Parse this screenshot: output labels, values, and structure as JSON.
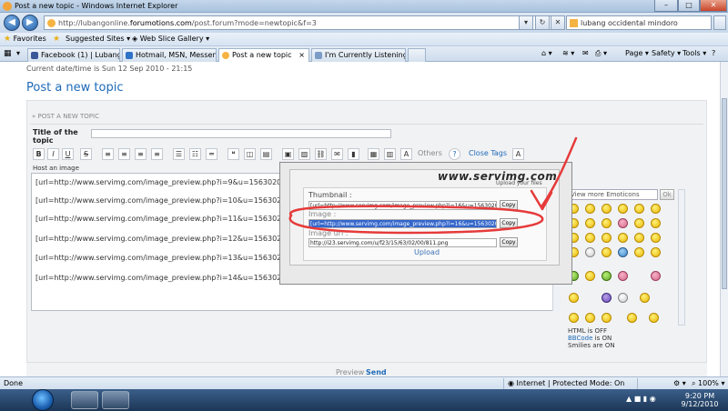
{
  "window": {
    "title": "Post a new topic - Windows Internet Explorer",
    "min": "–",
    "max": "□",
    "close": "✕"
  },
  "nav": {
    "url_host": "http://lubangonline.",
    "url_domain": "forumotions.com",
    "url_path": "/post.forum?mode=newtopic&f=3",
    "search_text": "lubang occidental mindoro",
    "refresh": "↻",
    "stop": "✕",
    "go": "→"
  },
  "favorites": {
    "label": "Favorites",
    "items": [
      "Suggested Sites ▾",
      "Web Slice Gallery ▾"
    ]
  },
  "tabs": [
    {
      "label": "Facebook (1) | Lubang Tou...",
      "color": "#3b5998"
    },
    {
      "label": "Hotmail, MSN, Messenger ...",
      "color": "#2f73c8"
    },
    {
      "label": "Post a new topic",
      "color": "#f5b342"
    },
    {
      "label": "I'm Currently Listening To...",
      "color": "#7a9cc6"
    }
  ],
  "commands": {
    "page": "Page ▾",
    "safety": "Safety ▾",
    "tools": "Tools ▾",
    "help": "?",
    "close_tab": "×"
  },
  "page": {
    "datetime": "Current date/time is Sun 12 Sep 2010 - 21:15",
    "title": "Post a new topic",
    "panel_header": "» POST A NEW TOPIC",
    "title_label": "Title of the topic",
    "host_label": "Host an image",
    "toolbar": {
      "bold": "B",
      "italic": "I",
      "underline": "U",
      "strike": "S",
      "others": "Others",
      "help": "?",
      "close_tags": "Close Tags",
      "font": "A"
    },
    "lines": [
      "[url=http://www.servimg.com/image_preview.php?i=9&u=15630200][",
      "[url=http://www.servimg.com/image_preview.php?i=10&u=15630200",
      "[url=http://www.servimg.com/image_preview.php?i=11&u=15630200",
      "[url=http://www.servimg.com/image_preview.php?i=12&u=15630200",
      "[url=http://www.servimg.com/image_preview.php?i=13&u=15630200",
      "[url=http://www.servimg.com/image_preview.php?i=14&u=15630200"
    ],
    "preview": "Preview",
    "send": "Send"
  },
  "popup": {
    "logo": "www.servimg.com",
    "logo_sub": "Upload your files",
    "thumbnail_label": "Thumbnail :",
    "thumbnail_value": "[url=http://www.servimg.com/image_preview.php?i=16&u=15630200][im",
    "image_label": "Image :",
    "image_value": "[url=http://www.servimg.com/image_preview.php?i=16&u=15630200][im",
    "url_label": "Image url :",
    "url_value": "http://i23.servimg.com/u/f23/15/63/02/00/811.png",
    "copy": "Copy",
    "upload": "Upload"
  },
  "emoticons": {
    "select": "View more Emoticons",
    "ok": "Ok",
    "html": "HTML is OFF",
    "bbcode_link": "BBCode",
    "bbcode_rest": " is ON",
    "smilies": "Smilies are ON"
  },
  "status": {
    "left": "Done",
    "zone": "Internet | Protected Mode: On",
    "zoom": "100%"
  },
  "taskbar": {
    "time": "9:20 PM",
    "date": "9/12/2010",
    "tray": "▲ ■ ▮ ◉"
  },
  "colors": {
    "accent": "#1e6ab8",
    "annotation": "#e63a3a",
    "selection": "#3366cc"
  }
}
